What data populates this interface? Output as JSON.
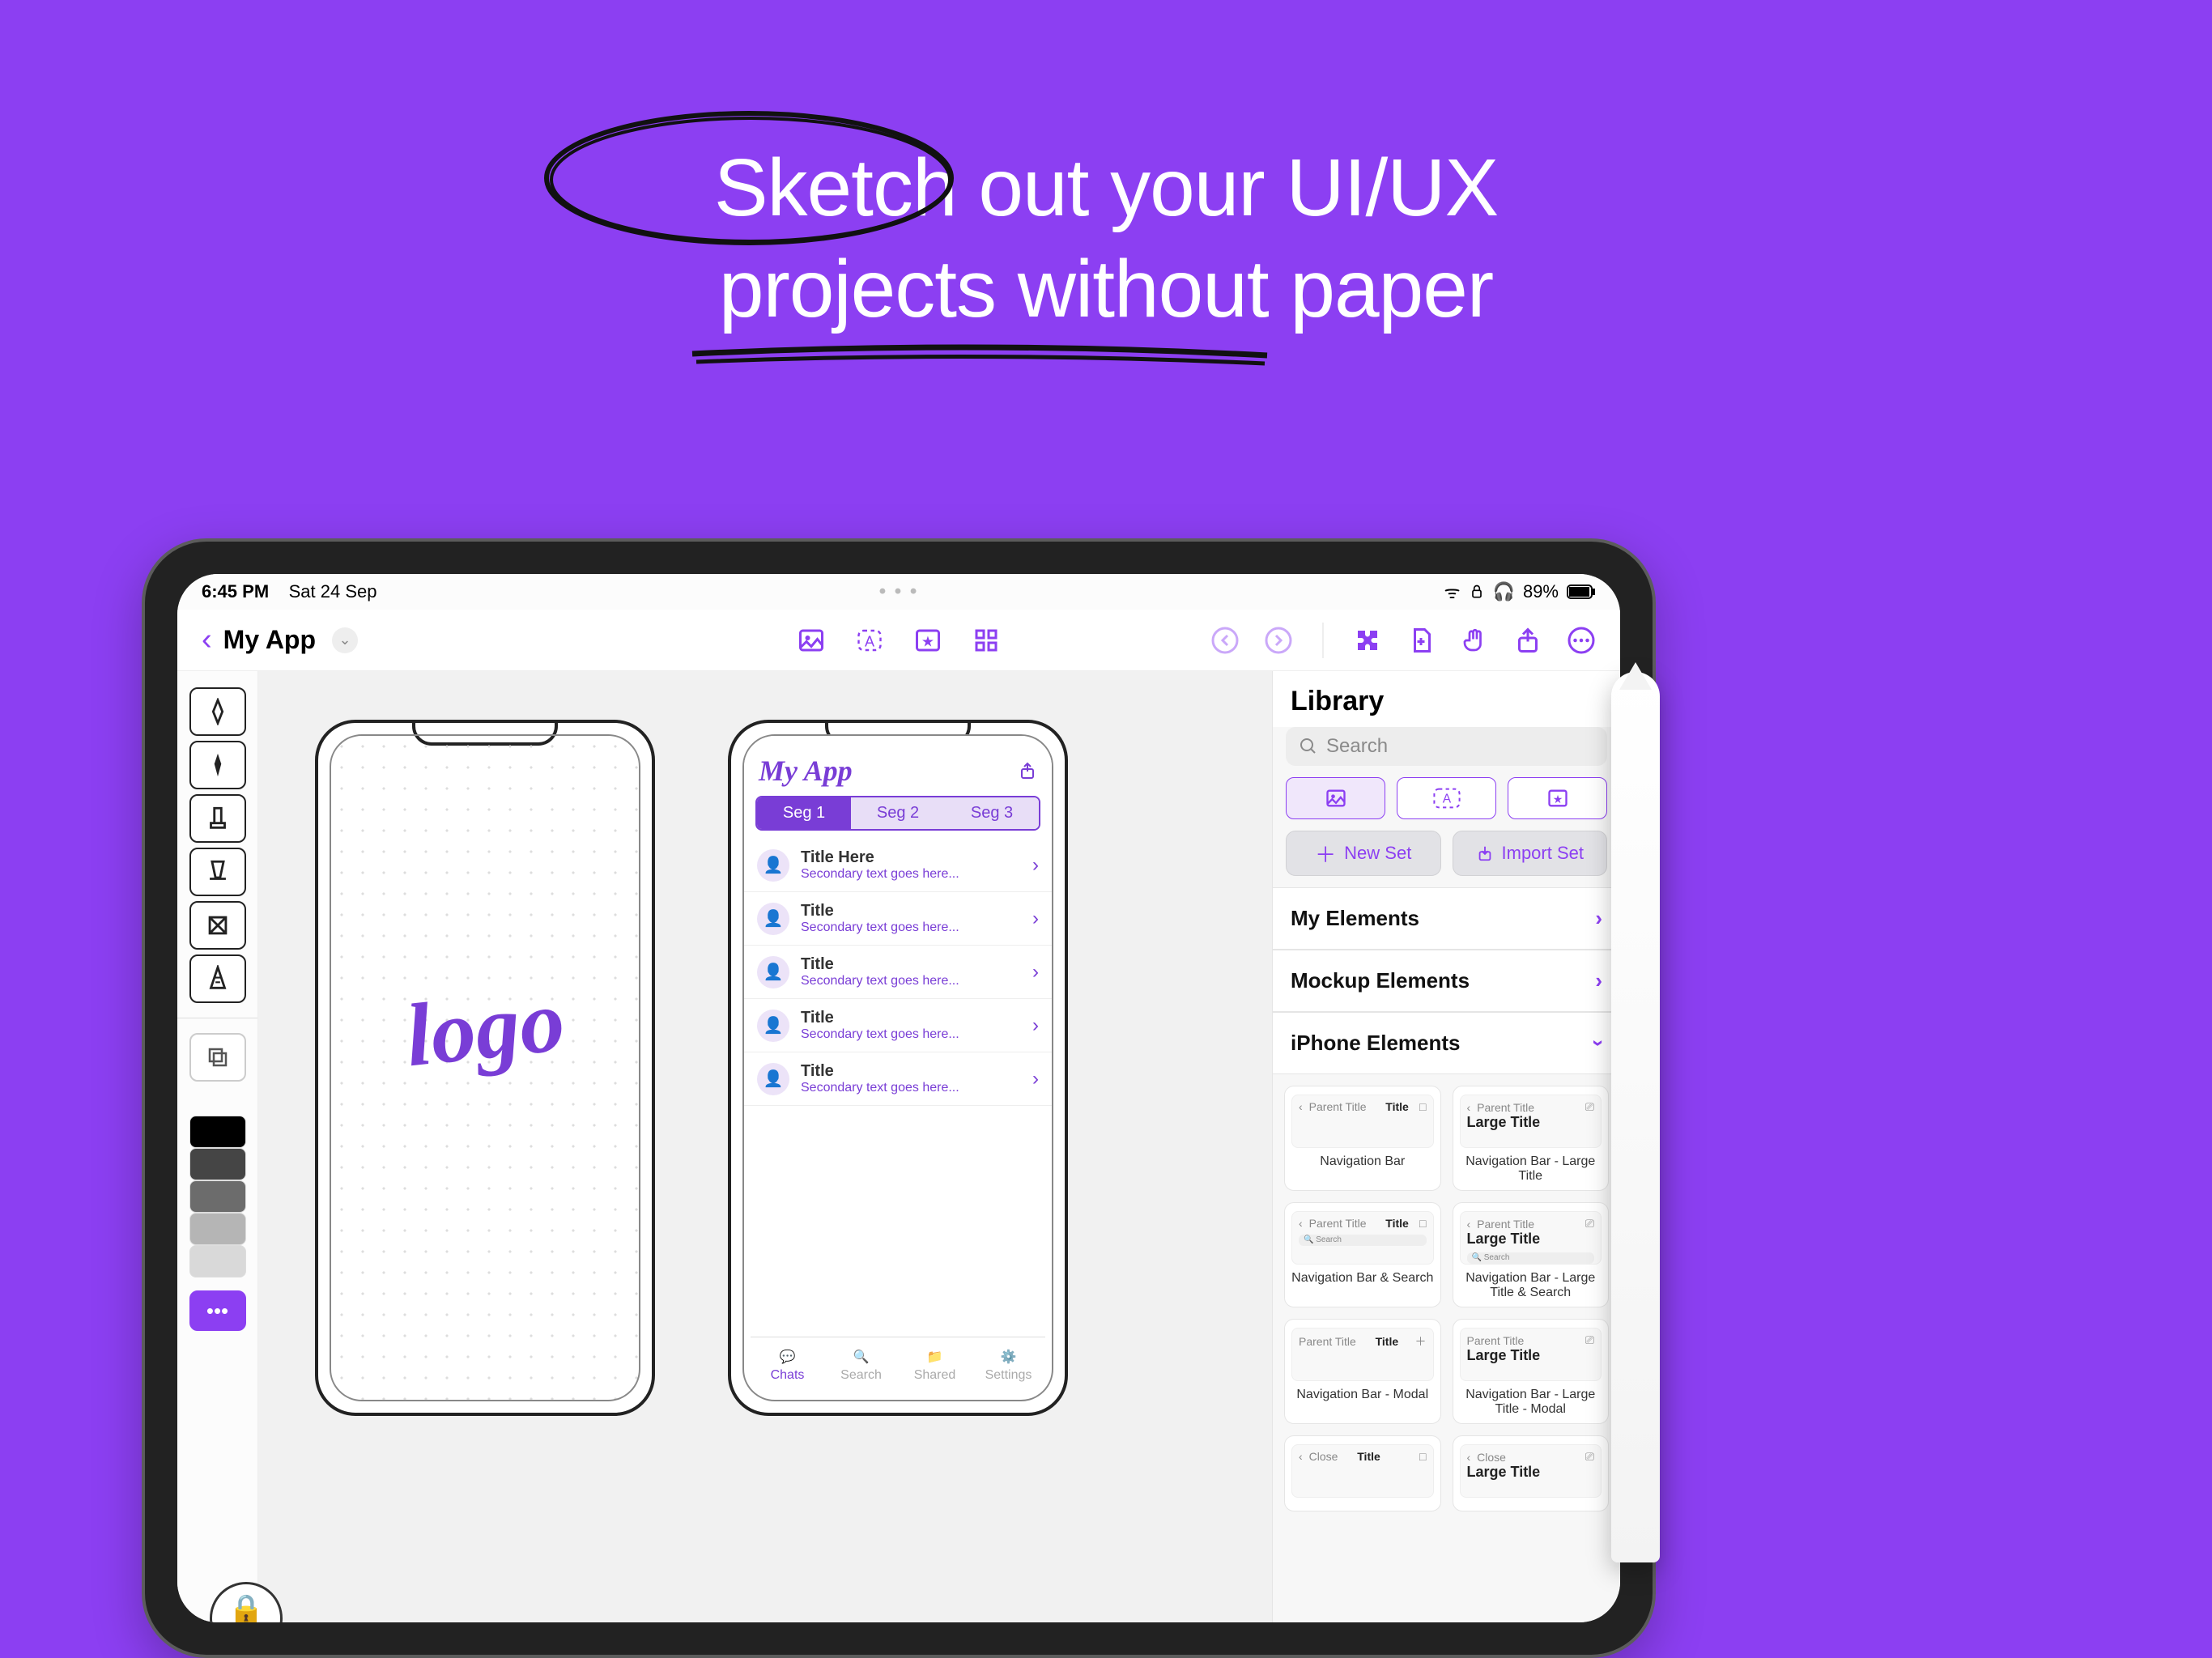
{
  "headline": {
    "line1": "Sketch out your UI/UX",
    "line2": "projects without paper"
  },
  "statusbar": {
    "time": "6:45 PM",
    "date": "Sat 24 Sep",
    "battery": "89%"
  },
  "toolbar": {
    "title": "My App"
  },
  "canvas": {
    "phone2": {
      "app_title": "My App",
      "segments": [
        "Seg 1",
        "Seg 2",
        "Seg 3"
      ],
      "rows": [
        {
          "title": "Title Here",
          "subtitle": "Secondary text goes here..."
        },
        {
          "title": "Title",
          "subtitle": "Secondary text goes here..."
        },
        {
          "title": "Title",
          "subtitle": "Secondary text goes here..."
        },
        {
          "title": "Title",
          "subtitle": "Secondary text goes here..."
        },
        {
          "title": "Title",
          "subtitle": "Secondary text goes here..."
        }
      ],
      "tabs": [
        "Chats",
        "Search",
        "Shared",
        "Settings"
      ]
    },
    "logo_text": "logo"
  },
  "library": {
    "title": "Library",
    "search_placeholder": "Search",
    "new_set": "New Set",
    "import_set": "Import Set",
    "sections": [
      "My Elements",
      "Mockup Elements",
      "iPhone Elements"
    ],
    "elements": [
      {
        "name": "Navigation Bar",
        "parent": "Parent Title",
        "title": "Title",
        "large": false,
        "search": false
      },
      {
        "name": "Navigation Bar - Large Title",
        "parent": "Parent Title",
        "title": "Large Title",
        "large": true,
        "search": false
      },
      {
        "name": "Navigation Bar & Search",
        "parent": "Parent Title",
        "title": "Title",
        "large": false,
        "search": true
      },
      {
        "name": "Navigation Bar - Large Title & Search",
        "parent": "Parent Title",
        "title": "Large Title",
        "large": true,
        "search": true
      },
      {
        "name": "Navigation Bar - Modal",
        "parent": "Parent Title",
        "title": "Title",
        "large": false,
        "search": false,
        "close": true
      },
      {
        "name": "Navigation Bar - Large Title - Modal",
        "parent": "Parent Title",
        "title": "Large Title",
        "large": true,
        "search": false,
        "close": true
      },
      {
        "name": "",
        "parent": "Close",
        "title": "Title",
        "large": false,
        "search": false
      },
      {
        "name": "",
        "parent": "Close",
        "title": "Large Title",
        "large": true,
        "search": false
      }
    ]
  },
  "colors": {
    "accent": "#8C3FF2",
    "swatches": [
      "#000000",
      "#454545",
      "#6c6c6c",
      "#b5b5b5",
      "#d9d9d9"
    ]
  }
}
